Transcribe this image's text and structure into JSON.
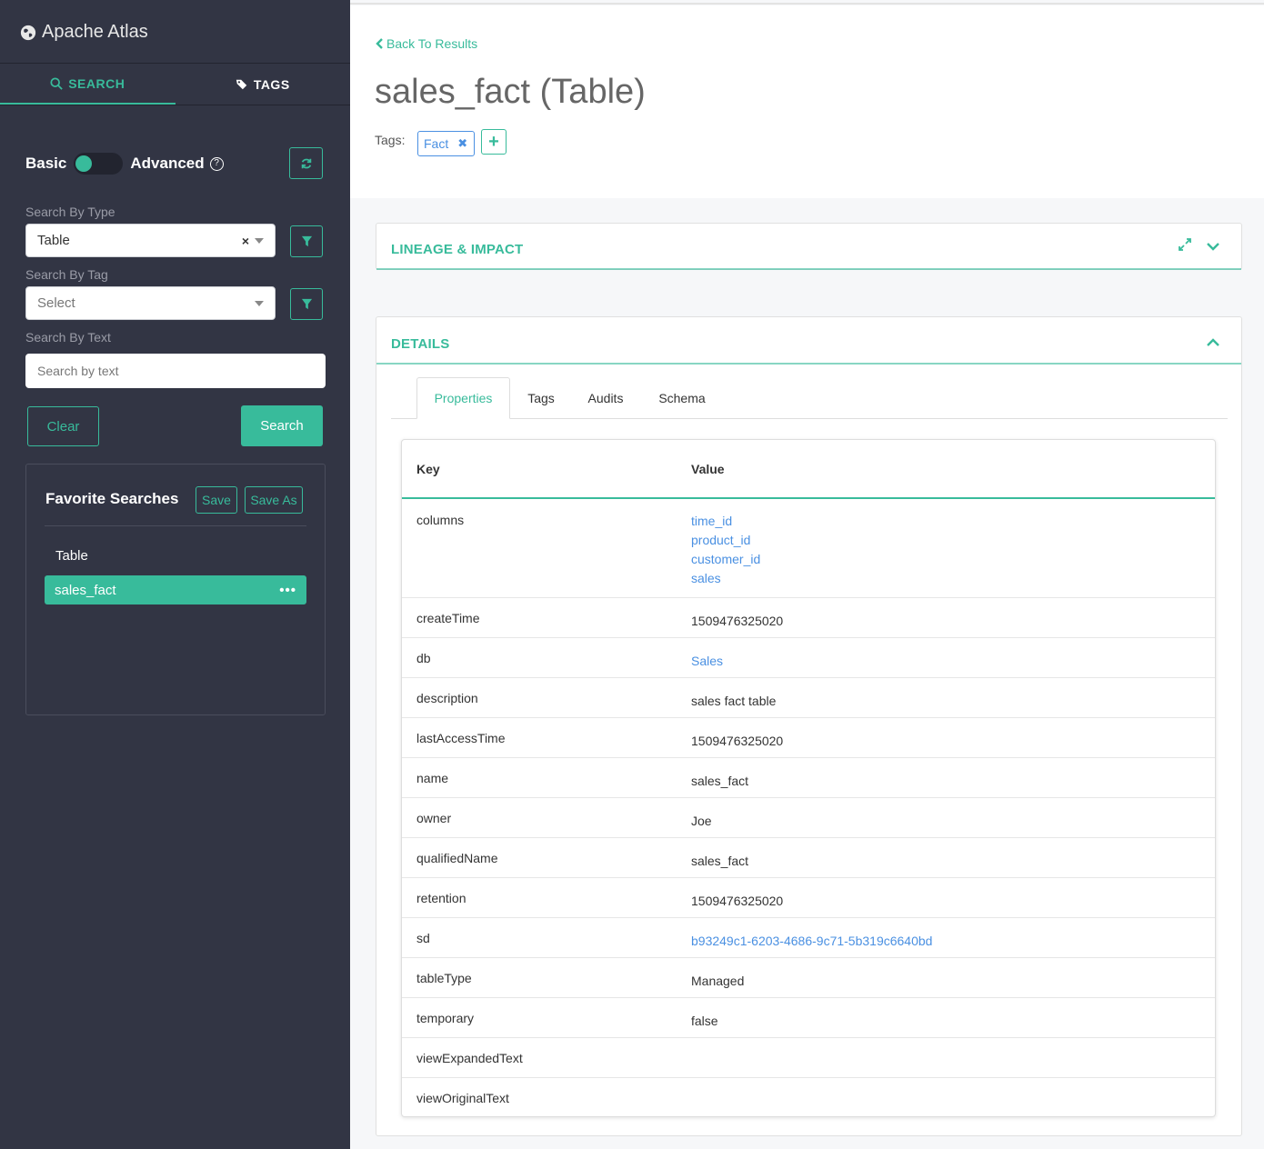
{
  "brand": {
    "title": "Apache Atlas"
  },
  "sidebar": {
    "tabs": [
      {
        "label": "SEARCH"
      },
      {
        "label": "TAGS"
      }
    ],
    "toggle": {
      "basic": "Basic",
      "advanced": "Advanced",
      "help": "?"
    },
    "search_by_type": {
      "label": "Search By Type",
      "value": "Table"
    },
    "search_by_tag": {
      "label": "Search By Tag",
      "placeholder": "Select"
    },
    "search_by_text": {
      "label": "Search By Text",
      "placeholder": "Search by text"
    },
    "clear_label": "Clear",
    "search_label": "Search",
    "favorites": {
      "title": "Favorite Searches",
      "save_label": "Save",
      "save_as_label": "Save As",
      "group": "Table",
      "items": [
        {
          "name": "sales_fact",
          "menu": "•••"
        }
      ]
    }
  },
  "header": {
    "back_label": "Back To Results",
    "title": "sales_fact (Table)",
    "tags_label": "Tags:",
    "tags": [
      {
        "name": "Fact",
        "remove": "✖"
      }
    ],
    "add_label": "+"
  },
  "lineage": {
    "title": "LINEAGE & IMPACT"
  },
  "details": {
    "title": "DETAILS",
    "tabs": [
      {
        "label": "Properties"
      },
      {
        "label": "Tags"
      },
      {
        "label": "Audits"
      },
      {
        "label": "Schema"
      }
    ],
    "active_tab": "Properties",
    "table": {
      "columns": [
        "Key",
        "Value"
      ],
      "rows": [
        {
          "key": "columns",
          "links": [
            "time_id",
            "product_id",
            "customer_id",
            "sales"
          ]
        },
        {
          "key": "createTime",
          "value": "1509476325020"
        },
        {
          "key": "db",
          "link": "Sales"
        },
        {
          "key": "description",
          "value": "sales fact table"
        },
        {
          "key": "lastAccessTime",
          "value": "1509476325020"
        },
        {
          "key": "name",
          "value": "sales_fact"
        },
        {
          "key": "owner",
          "value": "Joe"
        },
        {
          "key": "qualifiedName",
          "value": "sales_fact"
        },
        {
          "key": "retention",
          "value": "1509476325020"
        },
        {
          "key": "sd",
          "link": "b93249c1-6203-4686-9c71-5b319c6640bd"
        },
        {
          "key": "tableType",
          "value": "Managed"
        },
        {
          "key": "temporary",
          "value": "false"
        },
        {
          "key": "viewExpandedText",
          "value": ""
        },
        {
          "key": "viewOriginalText",
          "value": ""
        }
      ]
    }
  },
  "colors": {
    "accent": "#38bb9b",
    "sidebar_bg": "#323544",
    "link": "#4a90e2"
  }
}
